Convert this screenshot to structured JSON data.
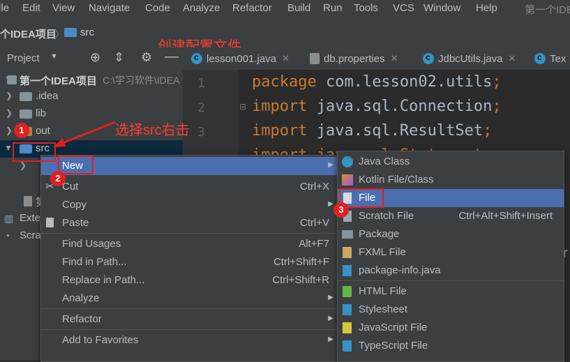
{
  "menu": [
    "ile",
    "Edit",
    "View",
    "Navigate",
    "Code",
    "Analyze",
    "Refactor",
    "Build",
    "Run",
    "Tools",
    "VCS",
    "Window",
    "Help"
  ],
  "window_title_partial": "第一个IDE",
  "breadcrumb": {
    "project": "个IDEA项目",
    "folder": "src"
  },
  "annotation_top": "创建配置文件",
  "project_panel": {
    "title": "Project"
  },
  "tabs": [
    {
      "label": "lesson001.java",
      "icon": "java-class-icon"
    },
    {
      "label": "db.properties",
      "icon": "properties-file-icon"
    },
    {
      "label": "JdbcUtils.java",
      "icon": "java-class-icon"
    },
    {
      "label": "Tex",
      "icon": "java-class-icon"
    }
  ],
  "tree": {
    "root": "第一个IDEA项目",
    "root_path": "C:\\学习软件\\IDEA",
    "items": [
      ".idea",
      "lib",
      "out",
      "src"
    ],
    "cut_labels": [
      "第",
      "Exte",
      "Scra"
    ]
  },
  "annotation_src": "选择src右击",
  "code": {
    "line_numbers": [
      "1",
      "2",
      "3"
    ],
    "lines": [
      {
        "kw": "package",
        "rest": " com.lesson02.utils",
        "semi": ";"
      },
      {
        "kw": "import",
        "rest": " java.sql.Connection",
        "semi": ";"
      },
      {
        "kw": "import",
        "rest": " java.sql.ResultSet",
        "semi": ";"
      }
    ],
    "partial_line": "import java.sql.Statement;",
    "side_char": "r"
  },
  "context_menu": [
    {
      "label": "New",
      "shortcut": "",
      "submenu": true,
      "selected": true
    },
    {
      "label": "Cut",
      "shortcut": "Ctrl+X",
      "icon": "scissors-icon"
    },
    {
      "label": "Copy",
      "shortcut": "",
      "submenu": true
    },
    {
      "label": "Paste",
      "shortcut": "Ctrl+V",
      "icon": "clipboard-icon"
    },
    {
      "label": "Find Usages",
      "shortcut": "Alt+F7"
    },
    {
      "label": "Find in Path...",
      "shortcut": "Ctrl+Shift+F"
    },
    {
      "label": "Replace in Path...",
      "shortcut": "Ctrl+Shift+R"
    },
    {
      "label": "Analyze",
      "shortcut": "",
      "submenu": true
    },
    {
      "label": "Refactor",
      "shortcut": "",
      "submenu": true
    },
    {
      "label": "Add to Favorites",
      "shortcut": "",
      "submenu": true
    }
  ],
  "submenu": [
    {
      "label": "Java Class",
      "shortcut": "",
      "icon": "java-class-icon"
    },
    {
      "label": "Kotlin File/Class",
      "shortcut": "",
      "icon": "kotlin-icon"
    },
    {
      "label": "File",
      "shortcut": "",
      "icon": "file-icon",
      "selected": true
    },
    {
      "label": "Scratch File",
      "shortcut": "Ctrl+Alt+Shift+Insert",
      "icon": "scratch-file-icon"
    },
    {
      "label": "Package",
      "shortcut": "",
      "icon": "package-icon"
    },
    {
      "label": "FXML File",
      "shortcut": "",
      "icon": "fxml-icon"
    },
    {
      "label": "package-info.java",
      "shortcut": "",
      "icon": "package-info-icon"
    },
    {
      "label": "HTML File",
      "shortcut": "",
      "icon": "html-icon"
    },
    {
      "label": "Stylesheet",
      "shortcut": "",
      "icon": "css-icon"
    },
    {
      "label": "JavaScript File",
      "shortcut": "",
      "icon": "javascript-icon"
    },
    {
      "label": "TypeScript File",
      "shortcut": "",
      "icon": "typescript-icon"
    }
  ],
  "badges": [
    "1",
    "2",
    "3"
  ],
  "colors": {
    "selection": "#4b6eaf",
    "annotation": "#ff3b30",
    "keyword": "#cc7832"
  }
}
